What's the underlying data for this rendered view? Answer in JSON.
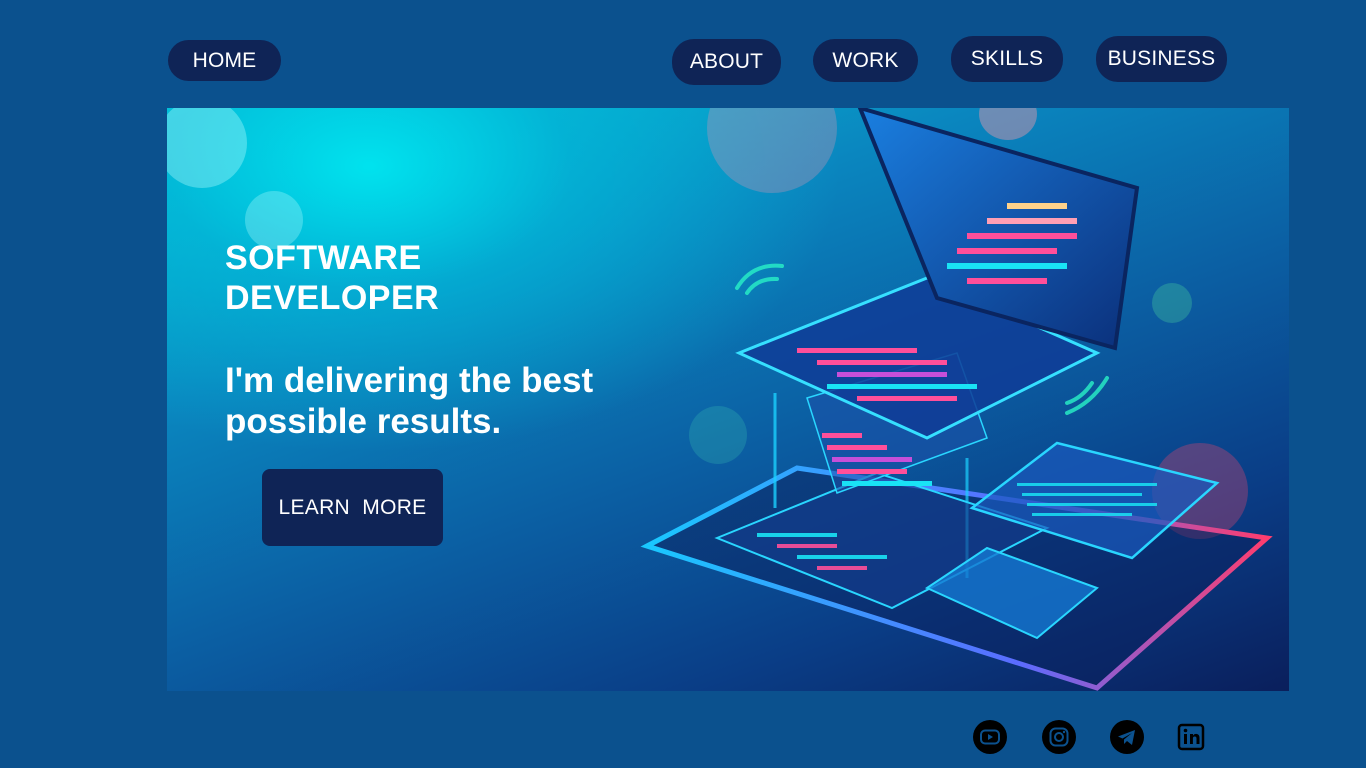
{
  "nav": {
    "home": "HOME",
    "about": "ABOUT",
    "work": "WORK",
    "skills": "SKILLS",
    "business": "BUSINESS"
  },
  "hero": {
    "title_line1": "SOFTWARE",
    "title_line2": "DEVELOPER",
    "subtitle_line1": "I'm delivering the best",
    "subtitle_line2": "possible results.",
    "cta_label": "LEARN  MORE",
    "illustration": "isometric-laptop-code-illustration"
  },
  "social": [
    {
      "icon": "youtube-icon"
    },
    {
      "icon": "instagram-icon"
    },
    {
      "icon": "telegram-icon"
    },
    {
      "icon": "linkedin-icon"
    }
  ],
  "colors": {
    "background": "#0b518e",
    "pill": "#0f2456",
    "text": "#ffffff",
    "accent_cyan": "#19e3f5",
    "accent_pink": "#ff4f9a"
  }
}
